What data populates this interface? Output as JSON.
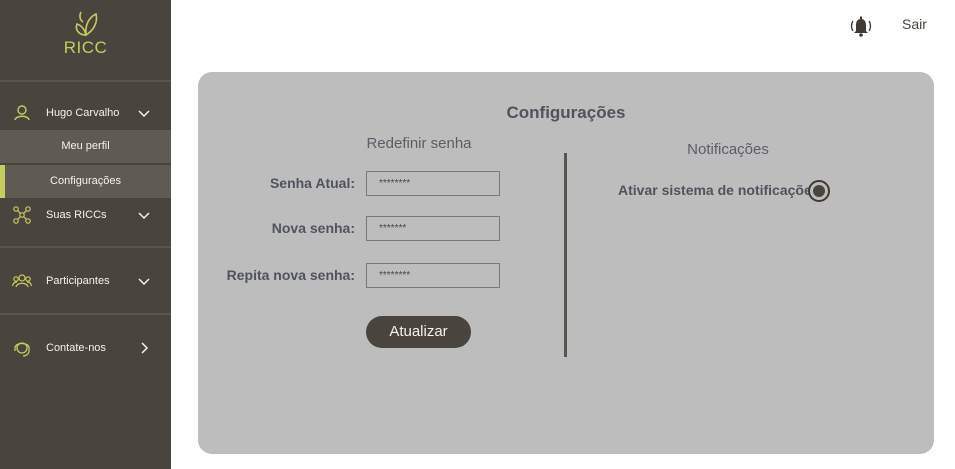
{
  "brand": {
    "name": "RICC",
    "accent_color": "#c7cc5f",
    "sidebar_color": "#4a443e"
  },
  "sidebar": {
    "user": {
      "name": "Hugo Carvalho",
      "icon": "user-icon",
      "chevron": "chevron-down-icon"
    },
    "user_submenu": [
      {
        "label": "Meu perfil"
      },
      {
        "label": "Configurações"
      }
    ],
    "items": [
      {
        "label": "Suas RICCs",
        "icon": "network-icon",
        "chevron": "chevron-down-icon"
      },
      {
        "label": "Participantes",
        "icon": "people-icon",
        "chevron": "chevron-down-icon"
      },
      {
        "label": "Contate-nos",
        "icon": "headset-icon",
        "chevron": "chevron-right-icon"
      }
    ]
  },
  "topbar": {
    "notifications_icon": "bell-icon",
    "logout_label": "Sair"
  },
  "settings": {
    "title": "Configurações",
    "password": {
      "title": "Redefinir senha",
      "current_label": "Senha Atual:",
      "current_value": "********",
      "new_label": "Nova senha:",
      "new_value": "*******",
      "repeat_label": "Repita nova senha:",
      "repeat_value": "********",
      "submit_label": "Atualizar"
    },
    "notifications": {
      "title": "Notificações",
      "enable_label": "Ativar sistema de notificações:",
      "enabled": true
    }
  }
}
